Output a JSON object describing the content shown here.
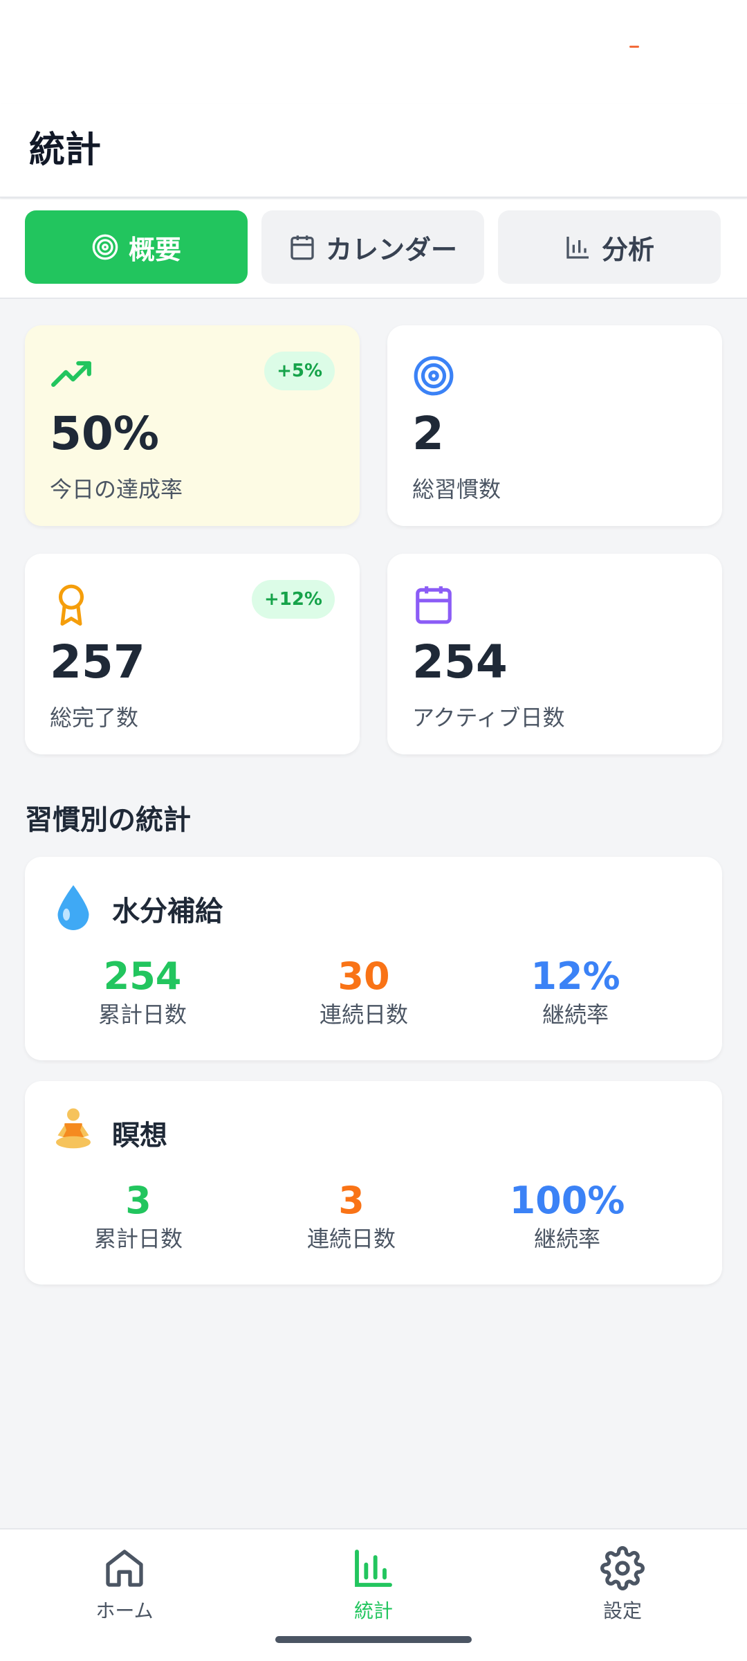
{
  "header": {
    "title": "統計"
  },
  "tabs": [
    {
      "label": "概要",
      "icon": "target-icon",
      "active": true
    },
    {
      "label": "カレンダー",
      "icon": "calendar-icon",
      "active": false
    },
    {
      "label": "分析",
      "icon": "bar-chart-icon",
      "active": false
    }
  ],
  "stats": {
    "today_rate": {
      "value": "50%",
      "label": "今日の達成率",
      "badge": "+5%",
      "icon": "trending-up-icon",
      "color": "#22c55e"
    },
    "total_habits": {
      "value": "2",
      "label": "総習慣数",
      "icon": "target-icon",
      "color": "#3b82f6"
    },
    "total_completions": {
      "value": "257",
      "label": "総完了数",
      "badge": "+12%",
      "icon": "award-icon",
      "color": "#f59e0b"
    },
    "active_days": {
      "value": "254",
      "label": "アクティブ日数",
      "icon": "calendar-icon",
      "color": "#8b5cf6"
    }
  },
  "habits_section": {
    "title": "習慣別の統計"
  },
  "habits": [
    {
      "name": "水分補給",
      "emoji": "droplet-icon",
      "total": "254",
      "total_label": "累計日数",
      "streak": "30",
      "streak_label": "連続日数",
      "rate": "12%",
      "rate_label": "継続率"
    },
    {
      "name": "瞑想",
      "emoji": "meditation-icon",
      "total": "3",
      "total_label": "累計日数",
      "streak": "3",
      "streak_label": "連続日数",
      "rate": "100%",
      "rate_label": "継続率"
    }
  ],
  "nav": [
    {
      "label": "ホーム",
      "icon": "home-icon",
      "active": false
    },
    {
      "label": "統計",
      "icon": "bar-chart-icon",
      "active": true
    },
    {
      "label": "設定",
      "icon": "gear-icon",
      "active": false
    }
  ],
  "colors": {
    "accent": "#22c55e",
    "streak": "#f97316",
    "rate": "#3b82f6"
  }
}
